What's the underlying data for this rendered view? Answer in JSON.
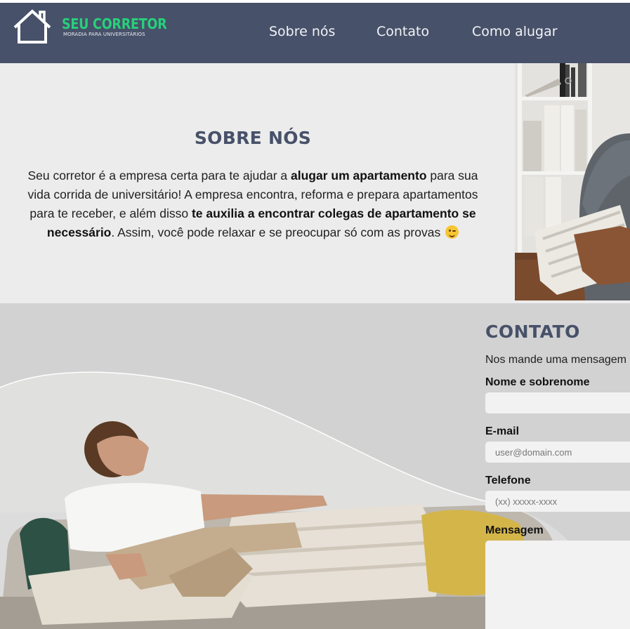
{
  "header": {
    "logo_name": "SEU CORRETOR",
    "logo_tagline": "MORADIA PARA UNIVERSITÁRIOS",
    "nav": [
      "Sobre nós",
      "Contato",
      "Como alugar"
    ]
  },
  "about": {
    "title": "SOBRE NÓS",
    "text_1": "Seu corretor é a empresa certa para te ajudar a ",
    "bold_1": "alugar um apartamento",
    "text_2": " para sua vida corrida de universitário! A empresa encontra, reforma e prepara apartamentos para te receber, e além disso ",
    "bold_2": "te auxilia a encontrar colegas de apartamento se necessário",
    "text_3": ". Assim, você pode relaxar e se preocupar só com as provas "
  },
  "contact": {
    "title": "CONTATO",
    "subtitle": "Nos mande uma mensagem e",
    "name_label": "Nome e sobrenome",
    "name_value": "",
    "email_label": "E-mail",
    "email_placeholder": "user@domain.com",
    "phone_label": "Telefone",
    "phone_placeholder": "(xx) xxxxx-xxxx",
    "message_label": "Mensagem",
    "message_value": ""
  },
  "colors": {
    "header_bg": "#475169",
    "brand_green": "#27d07b",
    "title_color": "#475169",
    "about_bg": "#ececec",
    "contact_bg": "#d2d2d2"
  }
}
